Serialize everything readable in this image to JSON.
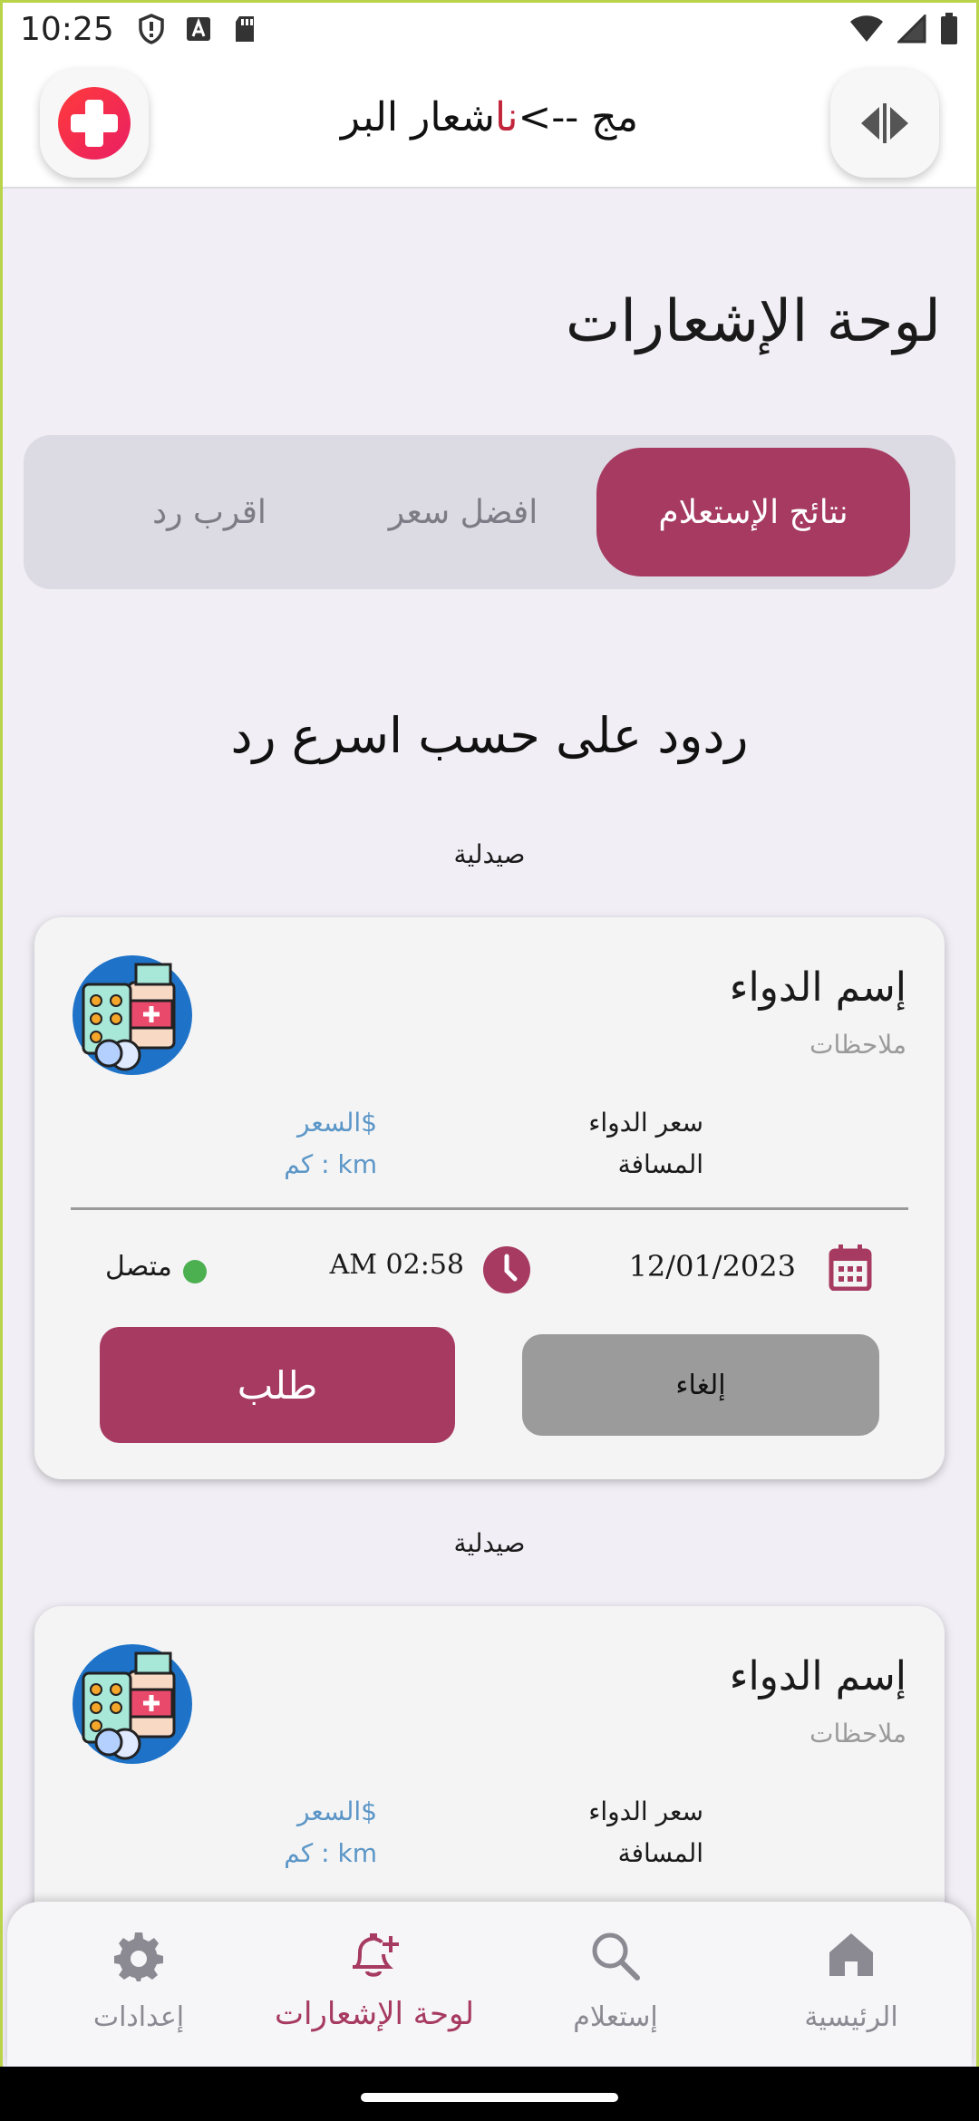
{
  "status_bar": {
    "time": "10:25"
  },
  "app_bar": {
    "logo_text_main": "شعار البر",
    "logo_text_accent": "نا",
    "logo_text_end": "مج -->"
  },
  "page": {
    "title": "لوحة الإشعارات",
    "section_heading": "ردود على حسب اسرع رد"
  },
  "tabs": [
    {
      "label": "نتائج الإستعلام",
      "active": true
    },
    {
      "label": "افضل سعر",
      "active": false
    },
    {
      "label": "اقرب رد",
      "active": false
    }
  ],
  "cards": [
    {
      "pharmacy_label": "صيدلية",
      "med_name": "إسم الدواء",
      "notes": "ملاحظات",
      "price_label": "سعر الدواء",
      "price_value": "$السعر",
      "distance_label": "المسافة",
      "distance_value": "km : كم",
      "date": "12/01/2023",
      "time": "AM 02:58",
      "status": "متصل",
      "request_button": "طلب",
      "cancel_button": "إلغاء"
    },
    {
      "pharmacy_label": "صيدلية",
      "med_name": "إسم الدواء",
      "notes": "ملاحظات",
      "price_label": "سعر الدواء",
      "price_value": "$السعر",
      "distance_label": "المسافة",
      "distance_value": "km : كم"
    }
  ],
  "bottom_nav": [
    {
      "label": "إعدادات",
      "icon": "gear-icon",
      "active": false
    },
    {
      "label": "لوحة الإشعارات",
      "icon": "bell-plus-icon",
      "active": true
    },
    {
      "label": "إستعلام",
      "icon": "search-icon",
      "active": false
    },
    {
      "label": "الرئيسية",
      "icon": "home-icon",
      "active": false
    }
  ],
  "colors": {
    "accent": "#a63a60",
    "online": "#4caf50",
    "link_blue": "#5b96c7"
  }
}
